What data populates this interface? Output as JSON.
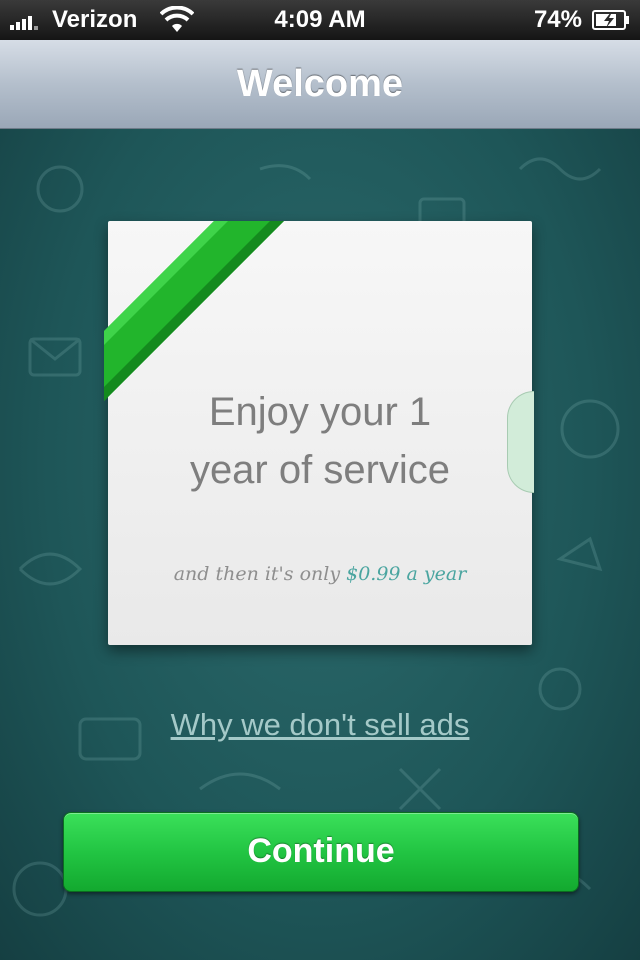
{
  "status_bar": {
    "carrier": "Verizon",
    "time": "4:09 AM",
    "battery": "74%"
  },
  "nav": {
    "title": "Welcome"
  },
  "card": {
    "headline_line1": "Enjoy your 1",
    "headline_line2": "year of service",
    "subtext_prefix": "and then it's only",
    "subtext_price": "$0.99 a year"
  },
  "link": {
    "ads": "Why we don't sell ads"
  },
  "button": {
    "continue": "Continue"
  },
  "colors": {
    "accent_green": "#22c543",
    "background_teal": "#1e5658",
    "price_teal": "#4aa5a0"
  }
}
